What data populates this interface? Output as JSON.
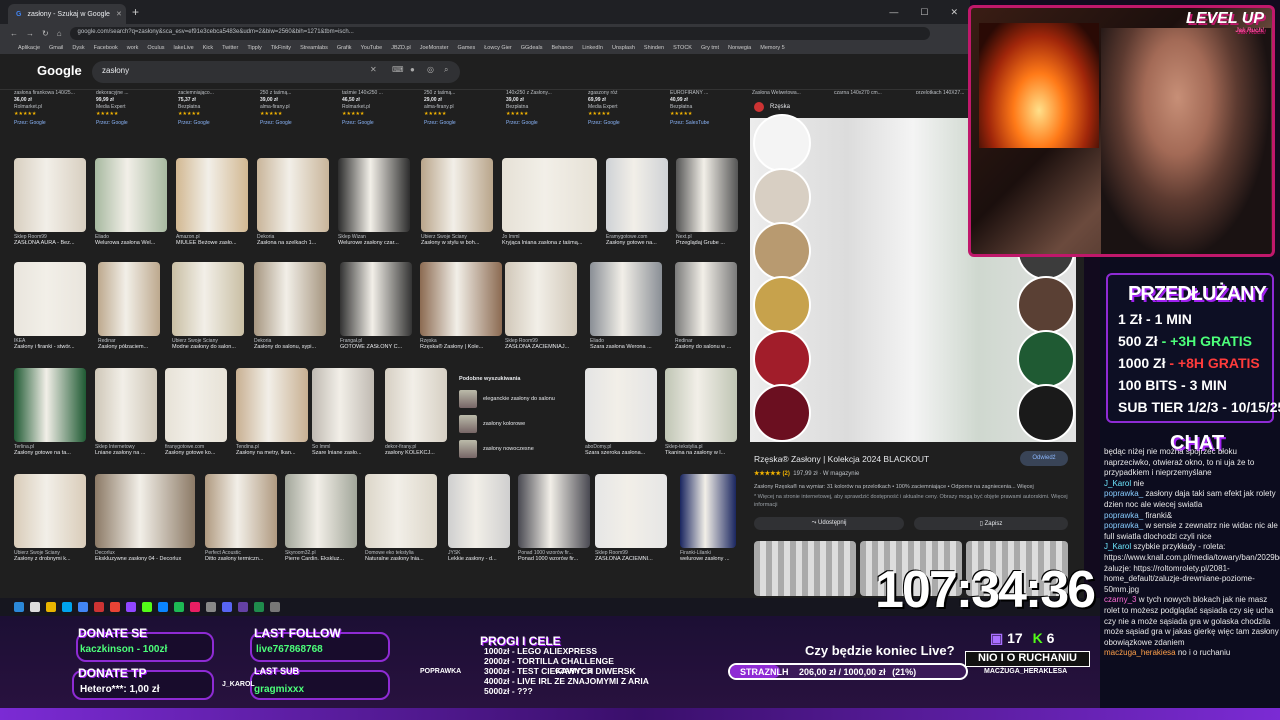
{
  "browser": {
    "tab_title": "zasłony - Szukaj w Google",
    "new_tab": "+",
    "url": "google.com/search?q=zasłony&sca_esv=ef91e3cebca5483e&udm=2&biw=2560&bih=1271&tbm=isch...",
    "bookmarks": [
      "Aplikacje",
      "Gmail",
      "Dysk",
      "Facebook",
      "work",
      "Oculus",
      "lakeLive",
      "Kick",
      "Twitter",
      "Tipply",
      "TikFinity",
      "Streamlabs",
      "Grafik",
      "YouTube",
      "JBZD.pl",
      "JoeMonster",
      "Games",
      "Łowcy Gier",
      "GGdeals",
      "Behance",
      "LinkedIn",
      "Unsplash",
      "Shinden",
      "STOCK",
      "Gry tmt",
      "Norwegia",
      "Memory 5"
    ]
  },
  "google": {
    "logo": "Google",
    "query": "zasłony",
    "shopping": [
      {
        "t": "zasłona firankowa 140/25...",
        "p": "36,00 zł",
        "s": "Rolmarket.pl",
        "z": "Przez: Google"
      },
      {
        "t": "dekoracyjne ...",
        "p": "99,99 zł",
        "s": "Media Expert",
        "z": "Przez: Google"
      },
      {
        "t": "zaciemniająco...",
        "p": "75,37 zł",
        "s": "Bezpłatna",
        "z": "Przez: Google"
      },
      {
        "t": "250 z taśmą...",
        "p": "39,00 zł",
        "s": "alma-firany.pl",
        "z": "Przez: Google"
      },
      {
        "t": "taśmie 140x250 ...",
        "p": "46,50 zł",
        "s": "Rolmarket.pl",
        "z": "Przez: Google"
      },
      {
        "t": "250 z taśmą...",
        "p": "29,00 zł",
        "s": "alma-firany.pl",
        "z": "Przez: Google"
      },
      {
        "t": "140x250 z Zasłony...",
        "p": "39,00 zł",
        "s": "Bezpłatna",
        "z": "Przez: Google"
      },
      {
        "t": "zgaszony róż",
        "p": "69,99 zł",
        "s": "Media Expert",
        "z": "Przez: Google"
      },
      {
        "t": "EUROFIRANY ...",
        "p": "40,99 zł",
        "s": "Bezpłatna",
        "z": "Przez: SalesTube"
      },
      {
        "t": "Zasłona Welwetowa...",
        "p": "58,91 zł",
        "s": "Bezpłatna",
        "z": "Przez: Kelkoo"
      },
      {
        "t": "czarna 140x270 cm...",
        "p": "58,91 zł",
        "s": "Bezpłatna",
        "z": "Przez: Google"
      },
      {
        "t": "przelotkach 140X27...",
        "p": "",
        "s": "",
        "z": ""
      },
      {
        "t": "AUSTRA 1x140x30...",
        "p": "",
        "s": "",
        "z": ""
      },
      {
        "t": "dzifiby",
        "p": "",
        "s": "",
        "z": ""
      }
    ],
    "images": [
      {
        "src": "Sklep Room99",
        "ttl": "ZASŁONA AURA - Bez..."
      },
      {
        "src": "Eliado",
        "ttl": "Welurowa zasłona Wel..."
      },
      {
        "src": "Amazon.pl",
        "ttl": "MIULEE Beżowe zasło..."
      },
      {
        "src": "Dekoria",
        "ttl": "Zasłona na szelkach 1..."
      },
      {
        "src": "Sklep Wizan",
        "ttl": "Welurowe zasłony czar..."
      },
      {
        "src": "Ubierz Swoje Ściany",
        "ttl": "Zasłony w stylu w boh..."
      },
      {
        "src": "Jo Imml",
        "ttl": "Kryjąca lniana zasłona z taśmą..."
      },
      {
        "src": "Eramygotowe.com",
        "ttl": "Zasłony gotowe na..."
      },
      {
        "src": "Next.pl",
        "ttl": "Przeglądaj Grube ..."
      },
      {
        "src": "IKEA",
        "ttl": "Zasłony i firanki - stwór..."
      },
      {
        "src": "Redinar",
        "ttl": "Zasłony półzaciem..."
      },
      {
        "src": "Ubierz Swoje Ściany",
        "ttl": "Modne zasłony do salon..."
      },
      {
        "src": "Dekoria",
        "ttl": "Zasłony do salonu, sypi..."
      },
      {
        "src": "Frangał.pl",
        "ttl": "GOTOWE ZASŁONY C..."
      },
      {
        "src": "Rzęska",
        "ttl": "Rzęska® Zasłony | Kole..."
      },
      {
        "src": "Sklep Room99",
        "ttl": "ZASŁONA ZACIEMNIAJ..."
      },
      {
        "src": "Eliado",
        "ttl": "Szara zasłona Werona ..."
      },
      {
        "src": "Redinar",
        "ttl": "Zasłony do salonu w ..."
      },
      {
        "src": "Terlina.pl",
        "ttl": "Zasłony gotowe na ta..."
      },
      {
        "src": "Sklep Internetowy",
        "ttl": "Lniane zasłony na ..."
      },
      {
        "src": "firanygotowe.com",
        "ttl": "Zasłony gotowe ko..."
      },
      {
        "src": "Tendina.pl",
        "ttl": "Zasłony na metry, lkan..."
      },
      {
        "src": "So Imml",
        "ttl": "Szare lniane zasło..."
      },
      {
        "src": "dekor-firany.pl",
        "ttl": "zasłony KOLEKCJ..."
      },
      {
        "src": "aboDomy.pl",
        "ttl": "Szara szeroka zasłona..."
      },
      {
        "src": "Sklep-tekstylia.pl",
        "ttl": "Tkanina na zasłony w l..."
      },
      {
        "src": "Ubierz Swoje Ściany",
        "ttl": "Zasłony z drobnymi k..."
      },
      {
        "src": "Decorlux",
        "ttl": "Ekskluzywne zasłony 04 - Decorlux"
      },
      {
        "src": "Perfect Acoustic",
        "ttl": "Ditto zasłony termiczn..."
      },
      {
        "src": "Skyroom32.pl",
        "ttl": "Pierre Cardin. Ekskluz..."
      },
      {
        "src": "Domowe eko tekstylia",
        "ttl": "Naturalne zasłony lnia..."
      },
      {
        "src": "JYSK",
        "ttl": "Lekkie zasłony - d..."
      },
      {
        "src": "Ponad 1000 wzorów fir...",
        "ttl": "Ponad 1000 wzorów fir..."
      },
      {
        "src": "Sklep Room99",
        "ttl": "ZASŁONA ZACIEMNI..."
      },
      {
        "src": "Firanki-Lilanki",
        "ttl": "welurowe zasłony ..."
      }
    ],
    "related": {
      "heading": "Podobne wyszukiwania",
      "items": [
        "eleganckie zasłony do salonu",
        "zasłony kolorowe",
        "zasłony nowoczesne"
      ]
    },
    "panel": {
      "site": "Rzęska",
      "title": "Rzęska® Zasłony | Kolekcja 2024 BLACKOUT",
      "visit": "Odwiedź",
      "stars": "★★★★★ (2)",
      "price": "197,99 zł · W magazynie",
      "desc": "Zasłony Rzęska® na wymiar: 31 kolorów na przelotkach • 100% zaciemniające • Odporne na zagniecenia...  Więcej",
      "note": "* Więcej na stronie internetowej, aby sprawdzić dostępność i aktualne ceny. Obrazy mogą być objęte prawami autorskimi. Więcej informacji",
      "share": "Udostępnij",
      "save": "Zapisz",
      "swatch_colors": [
        "#f4f4f4",
        "#d8cfc3",
        "#b89a70",
        "#c7a24c",
        "#a11d2a",
        "#6b0f20",
        "#3c3c3c",
        "#5a4034",
        "#1f5a33",
        "#1a1a1a"
      ]
    }
  },
  "overlay": {
    "level_up": "LEVEL UP",
    "level_sub": "Jak Ruch!",
    "przedluzany": "PRZEDŁUŻANY",
    "rows": [
      {
        "a": "1 Zł",
        "b": "- 1 MIN",
        "c": ""
      },
      {
        "a": "500 Zł",
        "b": "- +3H GRATIS",
        "c": "g"
      },
      {
        "a": "1000 Zł",
        "b": "- +8H GRATIS",
        "c": "red"
      },
      {
        "a": "100 BITS",
        "b": "- 3 MIN",
        "c": ""
      },
      {
        "a": "SUB TIER 1/2/3",
        "b": "- 10/15/25 MIN",
        "c": ""
      }
    ],
    "chat_title": "CHAT",
    "chat": [
      {
        "u": "",
        "m": "będąc niżej nie można spojrzeć błoku naprzeciwko, otwieraż okno, to ni uja że to przypadkiem i nieprzemyślane"
      },
      {
        "u": "J_Karol",
        "m": "nie"
      },
      {
        "u": "poprawka_",
        "m": "zasłony daja taki sam efekt jak rolety dzien noc ale wiecej swiatla"
      },
      {
        "u": "poprawka_",
        "m": "firanki&"
      },
      {
        "u": "poprawka_",
        "m": "w sensie z zewnatrz nie widac nic ale full swiatla dlochodzi czyli nice"
      },
      {
        "u": "J_Karol",
        "m": "szybkie przykłady - roleta: https://www.knall.com.pl/media/towary/ban/2029bc2b5f9efb362cf109e3/0f1d20011.jpg"
      },
      {
        "u": "",
        "m": "żaluzje: https://roltomrolety.pl/2081-home_default/zaluzje-drewniane-poziome-50mm.jpg"
      },
      {
        "u": "czarny_3",
        "m": "w tych nowych blokach jak nie masz rolet to możesz podglądać sąsiada czy się ucha czy nie a może sąsiada gra w golaska chodzila może sąsiad gra w jakas gierkę więc tam zasłony obowiązkowe zdaniem"
      },
      {
        "u": "macżuga_herakiesa",
        "m": "no i o ruchaniu"
      }
    ],
    "timer": "107:34:36",
    "donate_se_h": "DONATE SE",
    "donate_se_v": "kaczkinson - 100zł",
    "donate_tp_h": "DONATE TP",
    "donate_tp_v": "Hetero***: 1,00 zł",
    "last_follow_h": "LAST FOLLOW",
    "last_follow_v": "live767868768",
    "last_sub_h": "LAST SUB",
    "last_sub_v": "gragmixxx",
    "goals_h": "PROGI I CELE",
    "goals": [
      "1000zł - LEGO ALIEXPRESS",
      "2000zł - TORTILLA CHALLENGE",
      "3000zł - TEST CIEKAWYCH DIWERSK",
      "4000zł - LIVE IRL ZE ZNAJOMYMI Z ARIA",
      "5000zł - ???"
    ],
    "question": "Czy będzie koniec Live?",
    "progress_label": "STRAZNLH",
    "progress_value": "206,00 zł / 1000,00 zł",
    "progress_pct": "(21%)",
    "progress_fill": 0.21,
    "votes_a": "17",
    "votes_b": "6",
    "nio": "NIO I O RUCHANIU",
    "tag_macz": "MACŻUGA_HERAKLESA",
    "tag_popr": "POPRAWKA",
    "tag_jk": "J_KAROL",
    "tag_czarny": "CZARNY_3"
  }
}
